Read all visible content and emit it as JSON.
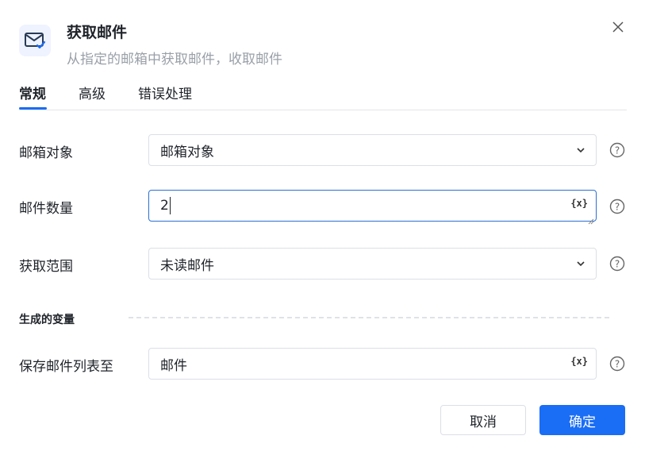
{
  "dialog": {
    "title": "获取邮件",
    "subtitle": "从指定的邮箱中获取邮件，收取邮件",
    "icon": "mail-check-icon",
    "close_icon": "close-icon"
  },
  "tabs": [
    {
      "label": "常规",
      "active": true
    },
    {
      "label": "高级",
      "active": false
    },
    {
      "label": "错误处理",
      "active": false
    }
  ],
  "fields": {
    "mailbox": {
      "label": "邮箱对象",
      "value": "邮箱对象",
      "control": "select"
    },
    "count": {
      "label": "邮件数量",
      "value": "2",
      "control": "text-with-variable"
    },
    "range": {
      "label": "获取范围",
      "value": "未读邮件",
      "control": "select"
    }
  },
  "output_section": {
    "title": "生成的变量",
    "save_to": {
      "label": "保存邮件列表至",
      "value": "邮件",
      "control": "text-with-variable"
    }
  },
  "variable_button_label": "{x}",
  "buttons": {
    "cancel": "取消",
    "confirm": "确定"
  },
  "colors": {
    "primary": "#1a6df5",
    "border": "#dcdfe6",
    "muted_text": "#9aa0a8"
  }
}
